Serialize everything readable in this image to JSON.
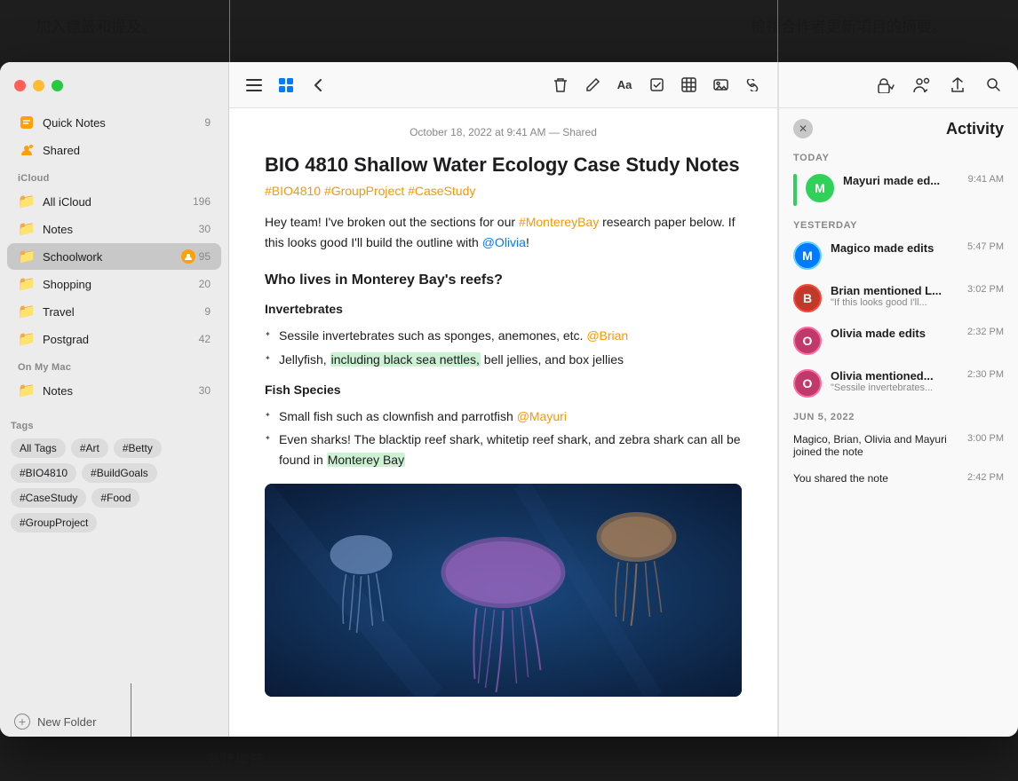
{
  "annotations": {
    "top_left": "加入標籤和提及。",
    "top_right": "檢視合作者更新項目的摘要。",
    "bottom": "瀏覽標籤。"
  },
  "sidebar": {
    "quick_notes_label": "Quick Notes",
    "quick_notes_count": "9",
    "shared_label": "Shared",
    "icloud_group": "iCloud",
    "all_icloud_label": "All iCloud",
    "all_icloud_count": "196",
    "notes_label": "Notes",
    "notes_count": "30",
    "schoolwork_label": "Schoolwork",
    "schoolwork_count": "95",
    "shopping_label": "Shopping",
    "shopping_count": "20",
    "travel_label": "Travel",
    "travel_count": "9",
    "postgrad_label": "Postgrad",
    "postgrad_count": "42",
    "on_my_mac_group": "On My Mac",
    "mac_notes_label": "Notes",
    "mac_notes_count": "30",
    "tags_group": "Tags",
    "tags": [
      "All Tags",
      "#Art",
      "#Betty",
      "#BIO4810",
      "#BuildGoals",
      "#CaseStudy",
      "#Food",
      "#GroupProject"
    ],
    "new_folder_label": "New Folder"
  },
  "toolbar": {
    "list_view_label": "☰",
    "grid_view_label": "⊞",
    "back_label": "‹",
    "delete_label": "🗑",
    "compose_label": "✏",
    "format_label": "Aa",
    "checklist_label": "☑",
    "table_label": "⊞",
    "media_label": "🖼",
    "link_label": "🔗"
  },
  "note": {
    "meta": "October 18, 2022 at 9:41 AM — Shared",
    "title": "BIO 4810 Shallow Water Ecology Case Study Notes",
    "hashtags": "#BIO4810  #GroupProject  #CaseStudy",
    "intro": "Hey team! I've broken out the sections for our ",
    "intro_link": "#MontereyBay",
    "intro_cont": " research paper below. If this looks good I'll build the outline with ",
    "intro_mention": "@Olivia",
    "intro_end": "!",
    "section1_title": "Who lives in Monterey Bay's reefs?",
    "section1_sub1": "Invertebrates",
    "bullet1": "Sessile invertebrates such as sponges, anemones, etc.",
    "bullet1_mention": "@Brian",
    "bullet2_pre": "Jellyfish,",
    "bullet2_highlight": "including black sea nettles,",
    "bullet2_post": " bell jellies, and box jellies",
    "section2_sub1": "Fish Species",
    "bullet3_pre": "Small fish such as clownfish and parrotfish",
    "bullet3_mention": "@Mayuri",
    "bullet4": "Even sharks! The blacktip reef shark, whitetip reef shark, and zebra shark can all be found in",
    "bullet4_highlight": "Monterey Bay"
  },
  "activity": {
    "title": "Activity",
    "today_label": "TODAY",
    "yesterday_label": "YESTERDAY",
    "jun_label": "JUN 5, 2022",
    "items_today": [
      {
        "name": "Mayuri made ed...",
        "time": "9:41 AM",
        "avatar_letter": "M",
        "avatar_color": "#30d158",
        "is_current": true
      }
    ],
    "items_yesterday": [
      {
        "name": "Magico made edits",
        "time": "5:47 PM",
        "avatar_letter": "M",
        "avatar_color": "#007aff",
        "border_color": "#64d2ff"
      },
      {
        "name": "Brian mentioned L...",
        "preview": "\"If this looks good I'll...",
        "time": "3:02 PM",
        "avatar_letter": "B",
        "avatar_color": "#ff3b30",
        "border_color": "#ff453a"
      },
      {
        "name": "Olivia made edits",
        "time": "2:32 PM",
        "avatar_letter": "O",
        "avatar_color": "#ff6b9d",
        "border_color": "#ff6b9d"
      },
      {
        "name": "Olivia mentioned...",
        "preview": "\"Sessile invertebrates...",
        "time": "2:30 PM",
        "avatar_letter": "O",
        "avatar_color": "#ff6b9d",
        "border_color": "#ff6b9d"
      }
    ],
    "items_jun": [
      {
        "name": "Magico, Brian, Olivia and Mayuri joined the note",
        "time": "3:00 PM"
      },
      {
        "name": "You shared the note",
        "time": "2:42 PM"
      }
    ]
  },
  "activity_toolbar_buttons": [
    {
      "label": "🔒",
      "name": "lock-button"
    },
    {
      "label": "👤",
      "name": "collaborators-button"
    },
    {
      "label": "↑",
      "name": "share-button"
    },
    {
      "label": "🔍",
      "name": "search-button"
    }
  ]
}
